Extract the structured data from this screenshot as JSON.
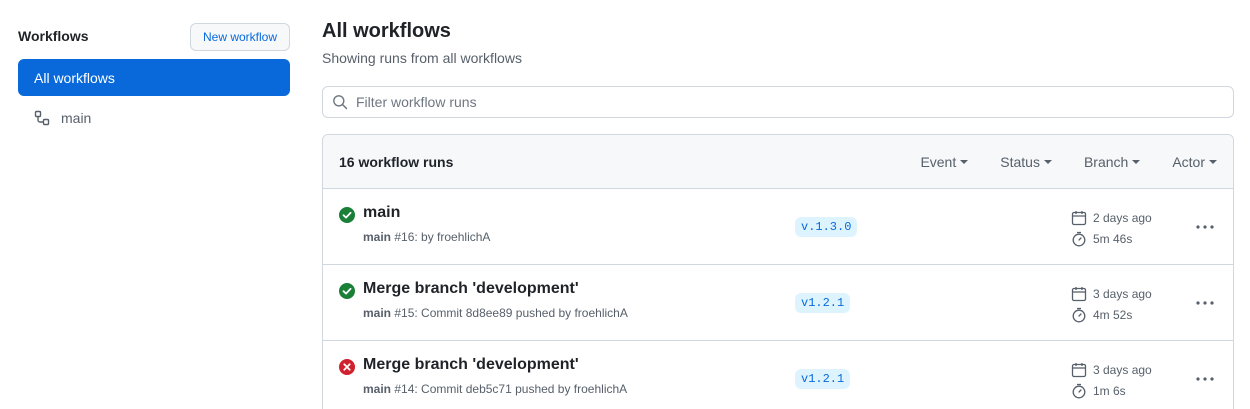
{
  "sidebar": {
    "title": "Workflows",
    "new_button": "New workflow",
    "items": [
      {
        "label": "All workflows",
        "active": true
      },
      {
        "label": "main",
        "active": false
      }
    ]
  },
  "main": {
    "title": "All workflows",
    "subtitle": "Showing runs from all workflows",
    "filter_placeholder": "Filter workflow runs",
    "run_count": "16 workflow runs",
    "filters": [
      "Event",
      "Status",
      "Branch",
      "Actor"
    ],
    "runs": [
      {
        "status": "success",
        "title": "main",
        "workflow": "main",
        "detail": "#16: by froehlichA",
        "tag": "v.1.3.0",
        "when": "2 days ago",
        "duration": "5m 46s"
      },
      {
        "status": "success",
        "title": "Merge branch 'development'",
        "workflow": "main",
        "detail": "#15: Commit 8d8ee89 pushed by froehlichA",
        "tag": "v1.2.1",
        "when": "3 days ago",
        "duration": "4m 52s"
      },
      {
        "status": "failure",
        "title": "Merge branch 'development'",
        "workflow": "main",
        "detail": "#14: Commit deb5c71 pushed by froehlichA",
        "tag": "v1.2.1",
        "when": "3 days ago",
        "duration": "1m 6s"
      }
    ]
  },
  "colors": {
    "accent": "#0969da",
    "success": "#1a7f37",
    "failure": "#cf222e",
    "border": "#d0d7de",
    "muted": "#57606a"
  }
}
